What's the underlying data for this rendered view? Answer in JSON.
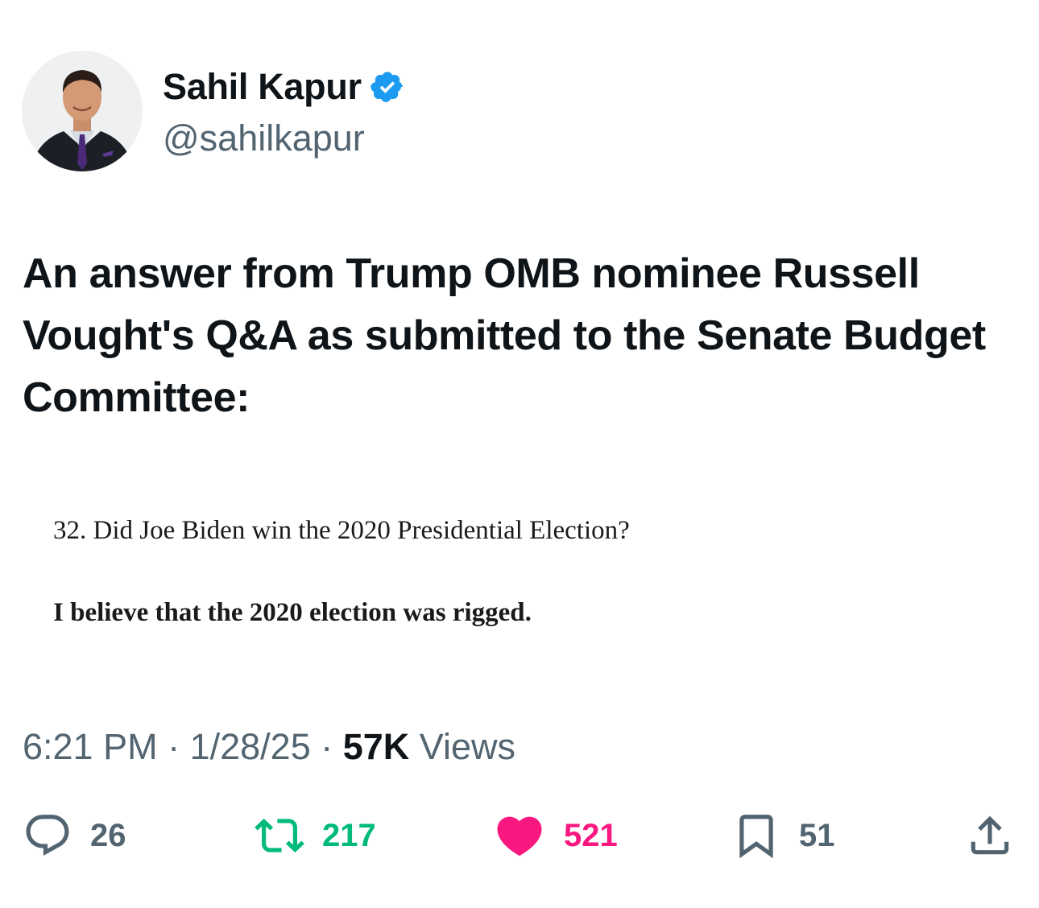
{
  "author": {
    "display_name": "Sahil Kapur",
    "handle": "@sahilkapur",
    "verified_icon": "verified-badge-icon",
    "avatar": "avatar"
  },
  "tweet": {
    "text": "An answer from Trump OMB nominee Russell Vought's Q&A as submitted to the Senate Budget Committee:"
  },
  "attached_image": {
    "question": "32.  Did Joe Biden win the 2020 Presidential Election?",
    "answer": "I believe that the 2020 election was rigged."
  },
  "meta": {
    "time": "6:21 PM",
    "separator1": " · ",
    "date": "1/28/25",
    "separator2": " · ",
    "views_count": "57K",
    "views_label": " Views"
  },
  "actions": {
    "reply": {
      "icon": "reply-icon",
      "count": "26",
      "color": "#536471"
    },
    "retweet": {
      "icon": "retweet-icon",
      "count": "217",
      "color": "#00ba7c"
    },
    "like": {
      "icon": "heart-icon",
      "count": "521",
      "color": "#f91880"
    },
    "bookmark": {
      "icon": "bookmark-icon",
      "count": "51",
      "color": "#536471"
    },
    "share": {
      "icon": "share-icon"
    }
  },
  "colors": {
    "verified": "#1d9bf0",
    "secondary_text": "#536471",
    "primary_text": "#0f1419"
  }
}
